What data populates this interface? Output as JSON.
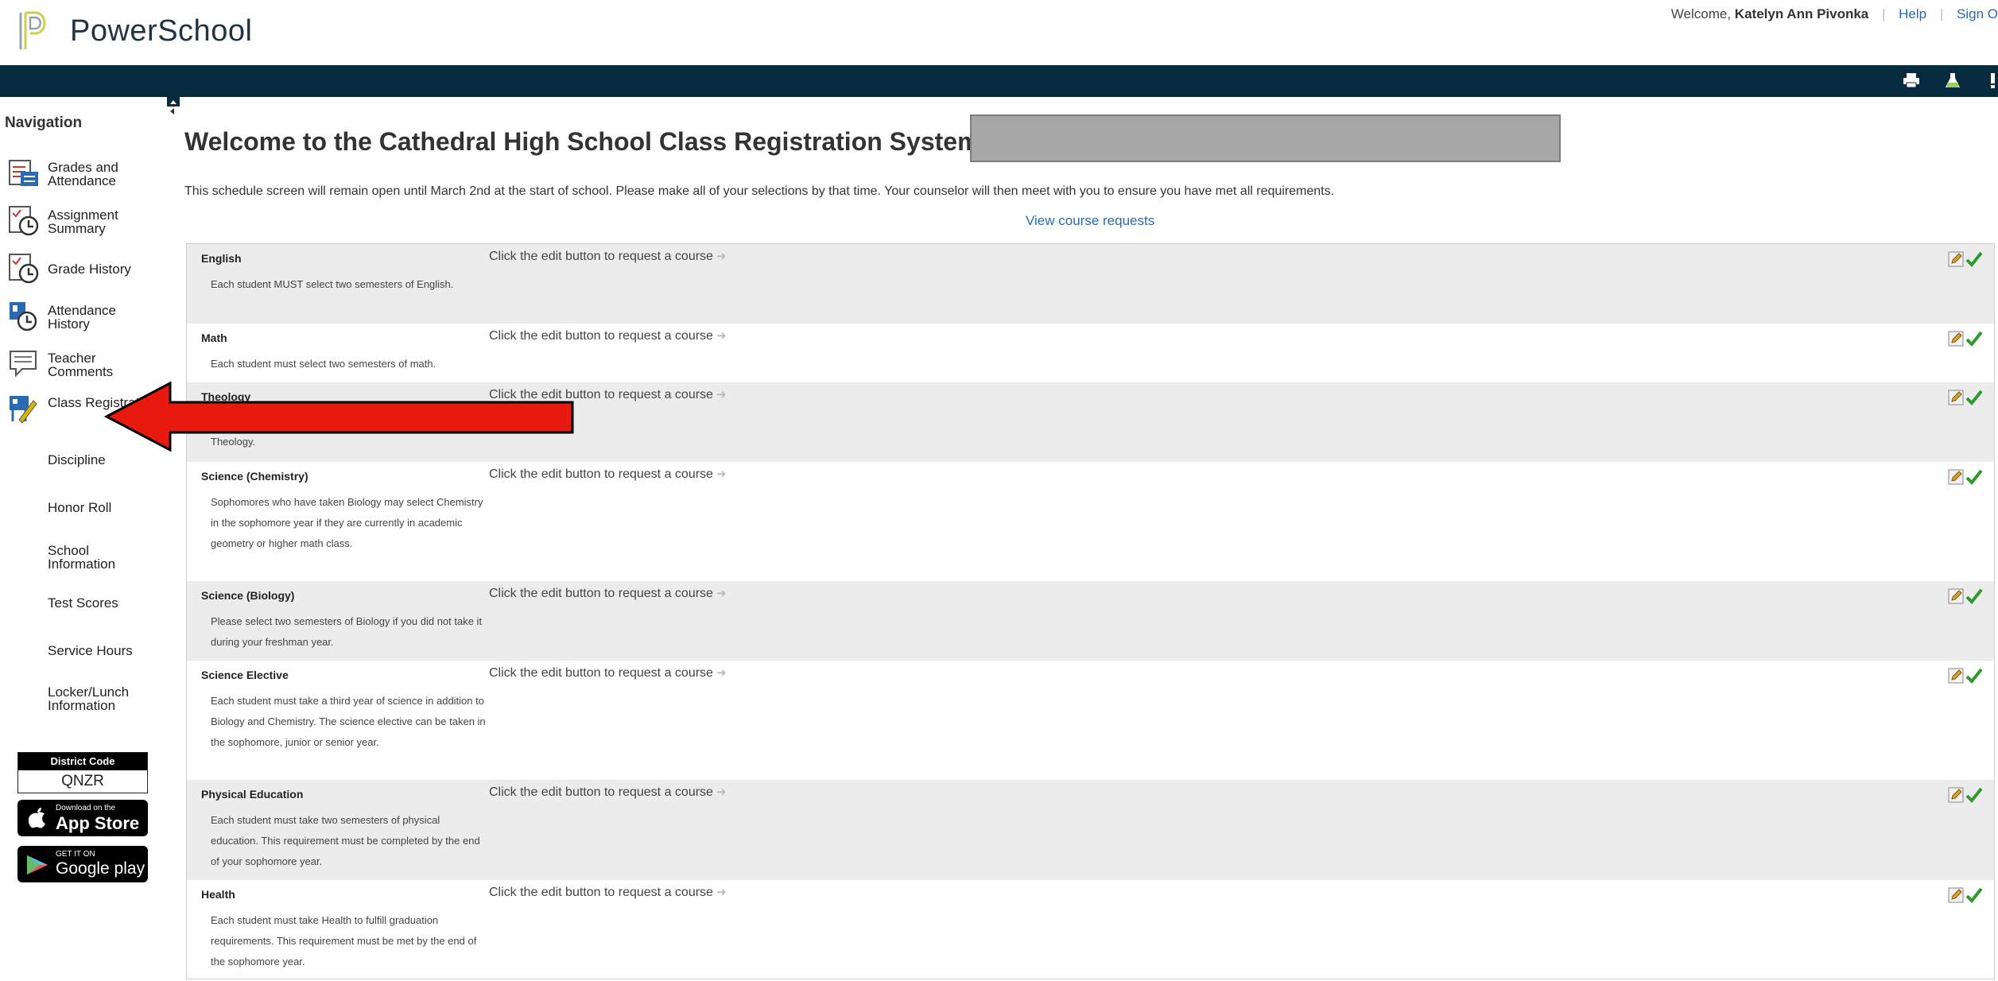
{
  "header": {
    "brand": "PowerSchool",
    "welcome_prefix": "Welcome,",
    "user_name": "Katelyn Ann Pivonka",
    "help_label": "Help",
    "signout_label": "Sign O"
  },
  "toolbar": {
    "icons": [
      "print-icon",
      "flask-icon",
      "alert-icon"
    ]
  },
  "nav": {
    "title": "Navigation",
    "items": [
      {
        "label": "Grades and Attendance",
        "icon": "grades-attendance-icon"
      },
      {
        "label": "Assignment Summary",
        "icon": "assignment-summary-icon"
      },
      {
        "label": "Grade History",
        "icon": "grade-history-icon"
      },
      {
        "label": "Attendance History",
        "icon": "attendance-history-icon"
      },
      {
        "label": "Teacher Comments",
        "icon": "teacher-comments-icon"
      },
      {
        "label": "Class Registration",
        "icon": "class-registration-icon"
      },
      {
        "label": "Discipline"
      },
      {
        "label": "Honor Roll"
      },
      {
        "label": "School Information"
      },
      {
        "label": "Test Scores"
      },
      {
        "label": "Service Hours"
      },
      {
        "label": "Locker/Lunch Information"
      }
    ],
    "district_code_label": "District Code",
    "district_code": "QNZR",
    "app_store_small": "Download on the",
    "app_store_big": "App Store",
    "google_small": "GET IT ON",
    "google_big": "Google play"
  },
  "main": {
    "title": "Welcome to the Cathedral High School Class Registration System fo",
    "intro": "This schedule screen will remain open until March 2nd at the start of school. Please make all of your selections by that time. Your counselor will then meet with you to ensure you have met all requirements.",
    "view_link": "View course requests",
    "prompt": "Click the edit button to request a course",
    "requests": [
      {
        "title": "English",
        "desc": "Each student MUST select two semesters of English."
      },
      {
        "title": "Math",
        "desc": "Each student must select two semesters of math."
      },
      {
        "title": "Theology",
        "desc": "Theology."
      },
      {
        "title": "Science (Chemistry)",
        "desc": "Sophomores who have taken Biology may select Chemistry in the sophomore year if they are currently in academic geometry or higher math class."
      },
      {
        "title": "Science (Biology)",
        "desc": "Please select two semesters of Biology if you did not take it during your freshman year."
      },
      {
        "title": "Science Elective",
        "desc": "Each student must take a third year of science in addition to Biology and Chemistry. The science elective can be taken in the sophomore, junior or senior year."
      },
      {
        "title": "Physical Education",
        "desc": "Each student must take two semesters of physical education. This requirement must be completed by the end of your sophomore year."
      },
      {
        "title": "Health",
        "desc": "Each student must take Health to fulfill graduation requirements. This requirement must be met by the end of the sophomore year."
      }
    ]
  },
  "colors": {
    "topbar": "#072c3f",
    "link": "#2a6ab0",
    "check": "#2e9a2e",
    "annotation_arrow": "#e8190f"
  }
}
